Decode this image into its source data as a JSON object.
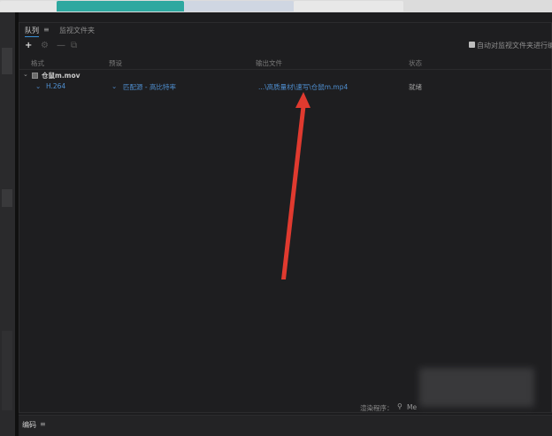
{
  "queue_panel": {
    "tab_queue": "队列",
    "tab_queue_menu": "≡",
    "tab_watch": "监视文件夹",
    "auto_encode": "自动对监视文件夹进行编",
    "columns": {
      "format": "格式",
      "preset": "预设",
      "output": "输出文件",
      "status": "状态"
    },
    "source": {
      "name": "仓鼠m.mov"
    },
    "output_item": {
      "format": "H.264",
      "preset": "匹配源 - 高比特率",
      "output_file": "...\\高质量材\\速写\\仓鼠m.mp4",
      "status": "就绪"
    },
    "renderer_label": "渲染程序：",
    "renderer_value": "Me"
  },
  "encoding_panel": {
    "title": "编码",
    "menu": "≡"
  },
  "icons": {
    "add": "plus-icon",
    "settings": "settings-icon",
    "remove": "minus-icon",
    "duplicate": "duplicate-icon"
  },
  "colors": {
    "accent_blue": "#4f8fd0",
    "annotation_red": "#e03a2f"
  }
}
